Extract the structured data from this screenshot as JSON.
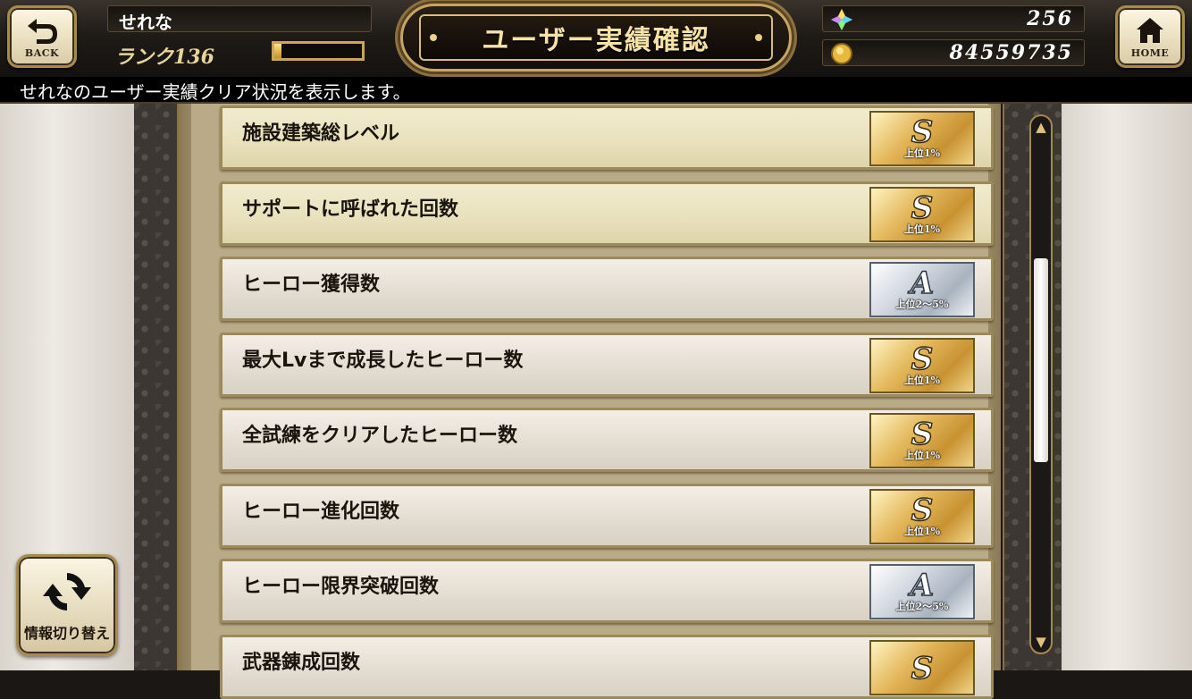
{
  "header": {
    "back_label": "BACK",
    "home_label": "HOME",
    "player_name": "せれな",
    "rank_text": "ランク136",
    "rank_progress": 0.08,
    "title": "ユーザー実績確認",
    "gems": "256",
    "coins": "84559735",
    "colors": {
      "gold": "#c7a564",
      "dark": "#141210"
    }
  },
  "description": "せれなのユーザー実績クリア状況を表示します。",
  "achievements": [
    {
      "label": "施設建築総レベル",
      "grade": "S",
      "tier": "上位1%",
      "highlight": true
    },
    {
      "label": "サポートに呼ばれた回数",
      "grade": "S",
      "tier": "上位1%",
      "highlight": true
    },
    {
      "label": "ヒーロー獲得数",
      "grade": "A",
      "tier": "上位2～5%",
      "highlight": false
    },
    {
      "label": "最大Lvまで成長したヒーロー数",
      "grade": "S",
      "tier": "上位1%",
      "highlight": false
    },
    {
      "label": "全試練をクリアしたヒーロー数",
      "grade": "S",
      "tier": "上位1%",
      "highlight": false
    },
    {
      "label": "ヒーロー進化回数",
      "grade": "S",
      "tier": "上位1%",
      "highlight": false
    },
    {
      "label": "ヒーロー限界突破回数",
      "grade": "A",
      "tier": "上位2～5%",
      "highlight": false
    },
    {
      "label": "武器錬成回数",
      "grade": "S",
      "tier": "",
      "highlight": false
    }
  ],
  "switch_button": {
    "label": "情報切り替え",
    "icon": "refresh-icon"
  },
  "scrollbar": {
    "position": 0.42
  }
}
